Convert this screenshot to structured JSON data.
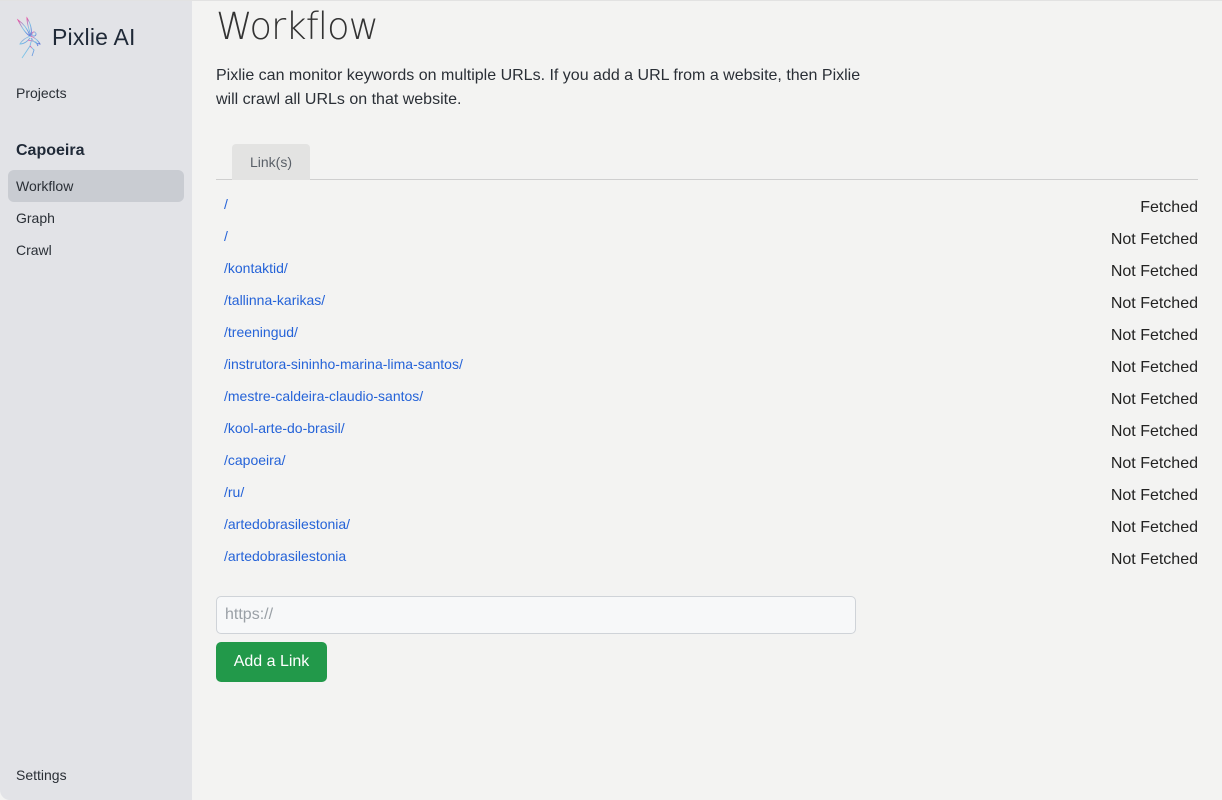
{
  "app": {
    "name": "Pixlie AI",
    "logo_icon": "fairy-logo-icon"
  },
  "sidebar": {
    "projects_label": "Projects",
    "project_name": "Capoeira",
    "items": [
      {
        "label": "Workflow",
        "active": true
      },
      {
        "label": "Graph",
        "active": false
      },
      {
        "label": "Crawl",
        "active": false
      }
    ],
    "settings_label": "Settings"
  },
  "main": {
    "title": "Workflow",
    "description": "Pixlie can monitor keywords on multiple URLs. If you add a URL from a website, then Pixlie will crawl all URLs on that website.",
    "tabs": [
      {
        "label": "Link(s)",
        "active": true
      }
    ],
    "links": [
      {
        "url": "/",
        "status": "Fetched"
      },
      {
        "url": "/",
        "status": "Not Fetched"
      },
      {
        "url": "/kontaktid/",
        "status": "Not Fetched"
      },
      {
        "url": "/tallinna-karikas/",
        "status": "Not Fetched"
      },
      {
        "url": "/treeningud/",
        "status": "Not Fetched"
      },
      {
        "url": "/instrutora-sininho-marina-lima-santos/",
        "status": "Not Fetched"
      },
      {
        "url": "/mestre-caldeira-claudio-santos/",
        "status": "Not Fetched"
      },
      {
        "url": "/kool-arte-do-brasil/",
        "status": "Not Fetched"
      },
      {
        "url": "/capoeira/",
        "status": "Not Fetched"
      },
      {
        "url": "/ru/",
        "status": "Not Fetched"
      },
      {
        "url": "/artedobrasilestonia/",
        "status": "Not Fetched"
      },
      {
        "url": "/artedobrasilestonia",
        "status": "Not Fetched"
      }
    ],
    "url_input": {
      "value": "",
      "placeholder": "https://"
    },
    "add_button_label": "Add a Link"
  },
  "colors": {
    "sidebar_bg": "#e2e3e7",
    "main_bg": "#f3f3f2",
    "active_item_bg": "#c9ccd2",
    "link": "#2563d8",
    "primary_button": "#22994a"
  }
}
